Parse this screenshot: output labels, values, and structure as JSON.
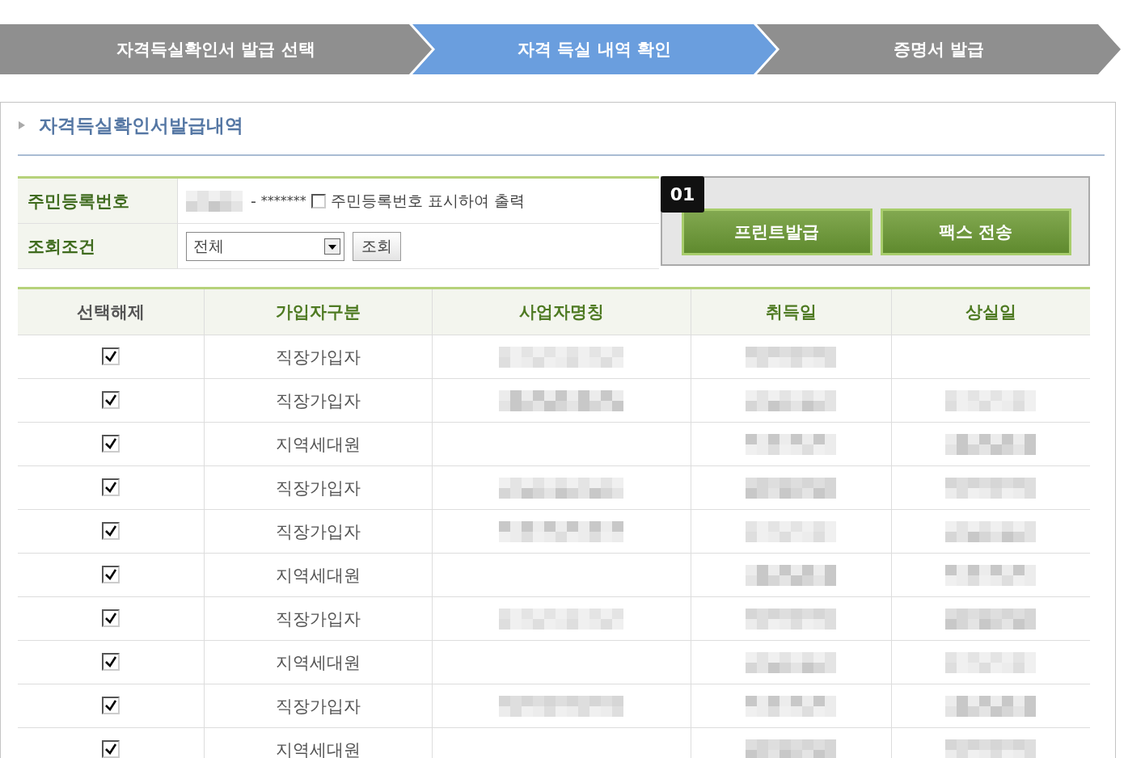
{
  "steps": [
    {
      "label": "자격득실확인서 발급 선택",
      "selected": false
    },
    {
      "label": "자격 득실 내역 확인",
      "selected": true
    },
    {
      "label": "증명서 발급",
      "selected": false
    }
  ],
  "panel": {
    "title": "자격득실확인서발급내역",
    "form": {
      "id_label": "주민등록번호",
      "id_prefix_redacted": true,
      "id_separator": "-",
      "id_masked": "*******",
      "show_id_label": "주민등록번호 표시하여 출력",
      "show_id_checked": false,
      "condition_label": "조회조건",
      "condition_value": "전체",
      "search_button": "조회"
    },
    "actions": {
      "badge": "01",
      "buttons": [
        "프린트발급",
        "팩스 전송"
      ]
    },
    "table": {
      "columns": [
        "선택해제",
        "가입자구분",
        "사업자명칭",
        "취득일",
        "상실일"
      ],
      "rows": [
        {
          "checked": true,
          "type": "직장가입자",
          "company_redacted": true,
          "acquired_redacted": true,
          "lost_redacted": false
        },
        {
          "checked": true,
          "type": "직장가입자",
          "company_redacted": true,
          "acquired_redacted": true,
          "lost_redacted": true
        },
        {
          "checked": true,
          "type": "지역세대원",
          "company_redacted": false,
          "acquired_redacted": true,
          "lost_redacted": true
        },
        {
          "checked": true,
          "type": "직장가입자",
          "company_redacted": true,
          "acquired_redacted": true,
          "lost_redacted": true
        },
        {
          "checked": true,
          "type": "직장가입자",
          "company_redacted": true,
          "acquired_redacted": true,
          "lost_redacted": true
        },
        {
          "checked": true,
          "type": "지역세대원",
          "company_redacted": false,
          "acquired_redacted": true,
          "lost_redacted": true
        },
        {
          "checked": true,
          "type": "직장가입자",
          "company_redacted": true,
          "acquired_redacted": true,
          "lost_redacted": true
        },
        {
          "checked": true,
          "type": "지역세대원",
          "company_redacted": false,
          "acquired_redacted": true,
          "lost_redacted": true
        },
        {
          "checked": true,
          "type": "직장가입자",
          "company_redacted": true,
          "acquired_redacted": true,
          "lost_redacted": true
        },
        {
          "checked": true,
          "type": "지역세대원",
          "company_redacted": false,
          "acquired_redacted": true,
          "lost_redacted": true
        }
      ]
    }
  }
}
